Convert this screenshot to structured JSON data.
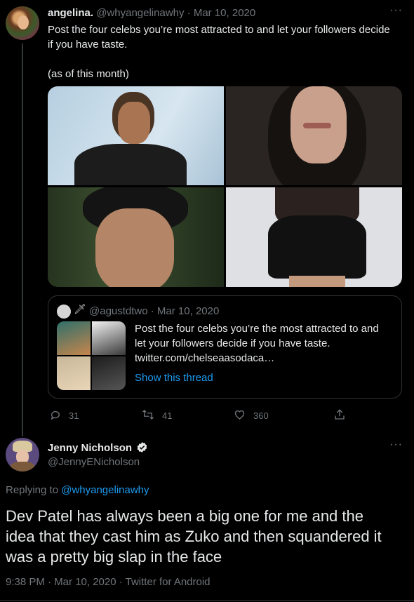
{
  "colors": {
    "background": "#000000",
    "text": "#e7e9ea",
    "muted": "#71767b",
    "link": "#1d9bf0",
    "border": "#2f3336"
  },
  "tweet1": {
    "display_name": "angelina.",
    "handle_date": "@whyangelinawhy · Mar 10, 2020",
    "text_line1": "Post the four celebs you’re most attracted to and let your followers decide",
    "text_line2": "if you have taste.",
    "text_line3": "(as of this month)",
    "more_icon": "more-dots-icon",
    "quote": {
      "handle_date": "@agustdtwo · Mar 10, 2020",
      "text_line1": "Post the four celebs you’re the most attracted to and",
      "text_line2": "let your followers decide if you have taste.",
      "link": "twitter.com/chelseaasodaca…",
      "show_thread": "Show this thread"
    },
    "stats": {
      "replies": "31",
      "retweets": "41",
      "likes": "360"
    }
  },
  "tweet2": {
    "display_name": "Jenny Nicholson",
    "handle": "@JennyENicholson",
    "replying_prefix": "Replying to ",
    "replying_handle": "@whyangelinawhy",
    "text_line1": "Dev Patel has always been a big one for me and the",
    "text_line2": "idea that they cast him as Zuko and then squandered it",
    "text_line3": "was a pretty big slap in the face",
    "meta_time": "9:38 PM · Mar 10, 2020 · ",
    "meta_source": "Twitter for Android"
  }
}
